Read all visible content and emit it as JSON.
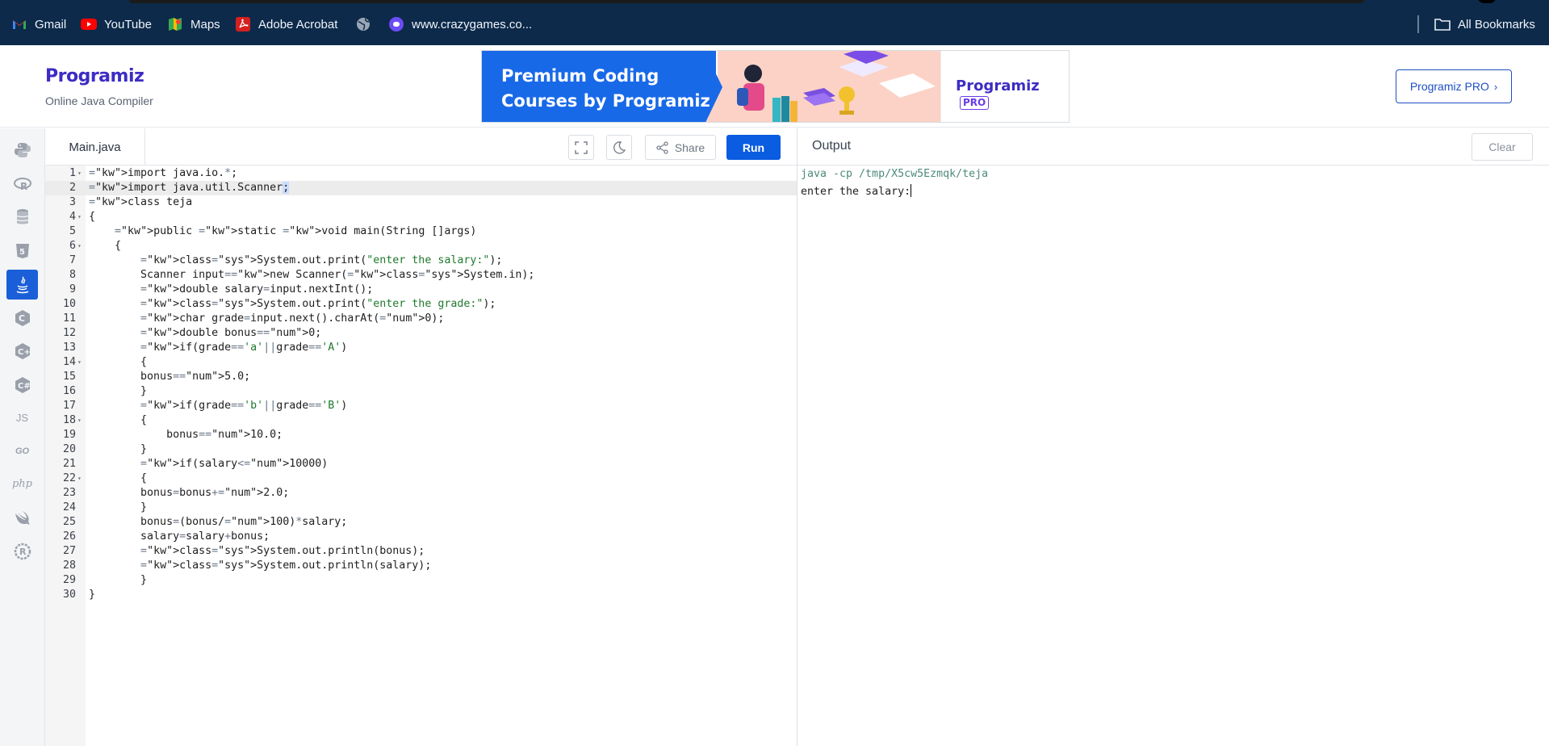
{
  "bookmarks": [
    {
      "label": "Gmail",
      "icon": "gmail-icon"
    },
    {
      "label": "YouTube",
      "icon": "youtube-icon"
    },
    {
      "label": "Maps",
      "icon": "maps-icon"
    },
    {
      "label": "Adobe Acrobat",
      "icon": "acrobat-icon"
    },
    {
      "label": "",
      "icon": "globe-icon"
    },
    {
      "label": "www.crazygames.co...",
      "icon": "crazygames-icon"
    }
  ],
  "all_bookmarks": "All Bookmarks",
  "header": {
    "logo": "Programiz",
    "subtitle": "Online Java Compiler",
    "banner_title": "Premium Coding Courses by Programiz",
    "banner_brand": "Programiz",
    "banner_badge": "PRO",
    "pro_button": "Programiz PRO"
  },
  "sidebar": {
    "languages": [
      "python",
      "r",
      "sql",
      "html",
      "java",
      "c",
      "cpp",
      "csharp",
      "js",
      "go",
      "php",
      "swift",
      "rust"
    ],
    "active": "java",
    "js_label": "JS",
    "go_label": "GO",
    "php_label": "php"
  },
  "editor": {
    "filename": "Main.java",
    "share_label": "Share",
    "run_label": "Run",
    "active_line": 2,
    "lines": [
      "import java.io.*;",
      "import java.util.Scanner;",
      "class teja",
      "{",
      "    public static void main(String []args)",
      "    {",
      "        System.out.print(\"enter the salary:\");",
      "        Scanner input=new Scanner(System.in);",
      "        double salary=input.nextInt();",
      "        System.out.print(\"enter the grade:\");",
      "        char grade=input.next().charAt(0);",
      "        double bonus=0;",
      "        if(grade=='a'||grade=='A')",
      "        {",
      "        bonus=5.0;",
      "        }",
      "        if(grade=='b'||grade=='B')",
      "        {",
      "            bonus=10.0;",
      "        }",
      "        if(salary<10000)",
      "        {",
      "        bonus=bonus+2.0;",
      "        }",
      "        bonus=(bonus/100)*salary;",
      "        salary=salary+bonus;",
      "        System.out.println(bonus);",
      "        System.out.println(salary);",
      "        }",
      "}"
    ],
    "foldable_lines": [
      1,
      4,
      6,
      14,
      18,
      22
    ]
  },
  "output": {
    "title": "Output",
    "clear_label": "Clear",
    "command": "java -cp /tmp/X5cw5Ezmqk/teja",
    "prompt": "enter the salary:"
  },
  "colors": {
    "bookmark_bar": "#0d2a4a",
    "accent": "#0a5ce0",
    "brand": "#3d2cc4"
  }
}
